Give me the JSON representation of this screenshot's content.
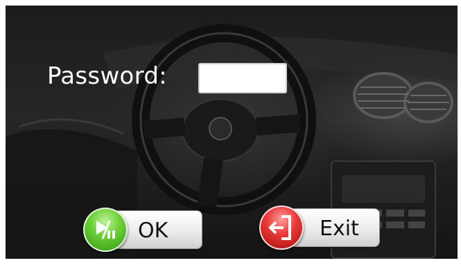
{
  "screen": {
    "background": "car-dashboard-interior",
    "background_tint": "#1e1e1e"
  },
  "login": {
    "password_label": "Password:",
    "password_value": "",
    "password_placeholder": ""
  },
  "buttons": {
    "ok": {
      "label": "OK",
      "icon": "play-pause-icon",
      "color": "#4fbf24"
    },
    "exit": {
      "label": "Exit",
      "icon": "exit-door-icon",
      "color": "#d82a2a"
    }
  }
}
